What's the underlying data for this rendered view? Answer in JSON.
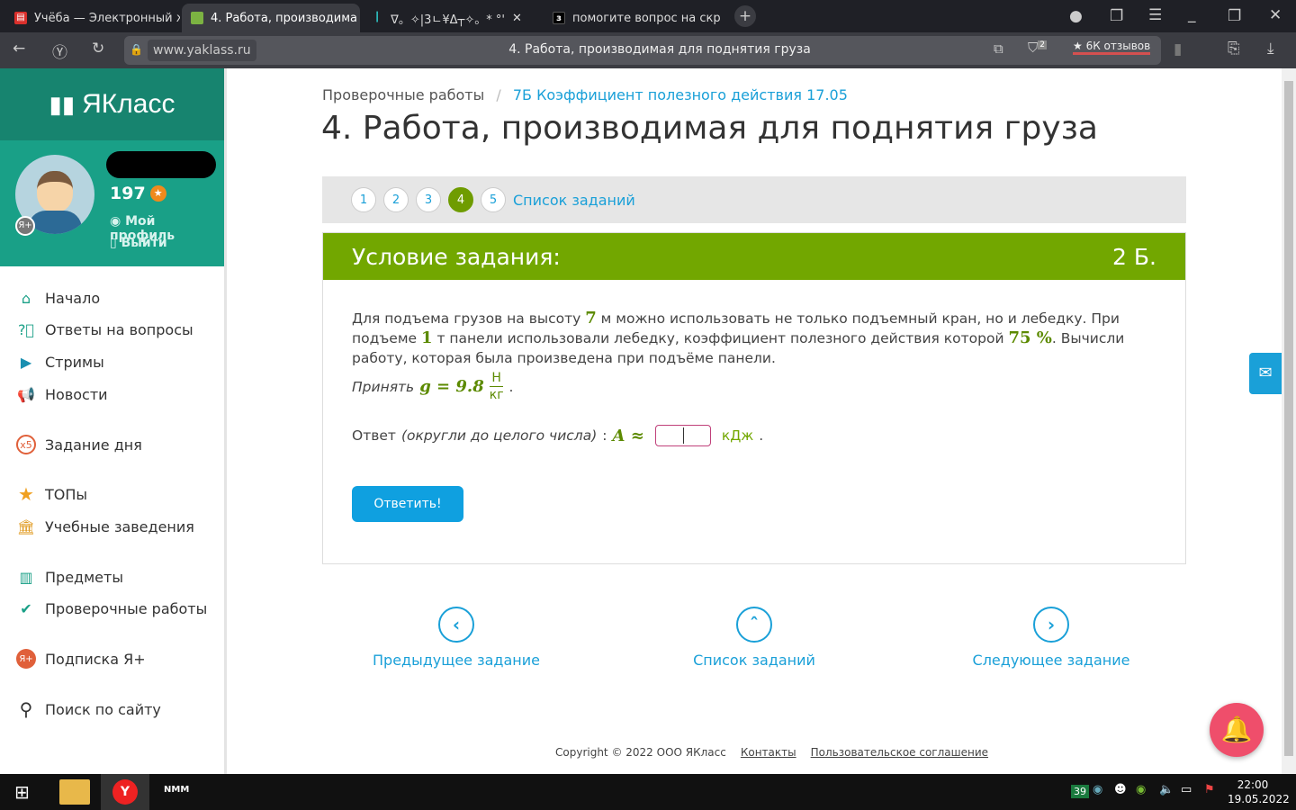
{
  "browser": {
    "tabs": [
      {
        "label": "Учёба — Электронный жу",
        "icon": "document-icon",
        "color": "#d9302c"
      },
      {
        "label": "4. Работа, производима",
        "icon": "yaklass-icon",
        "color": "#7cb342"
      },
      {
        "label": "ᐁ。✧|3ㄴ¥Δ┬✧。* °'",
        "icon": "audio-wave-icon",
        "color": "#2ec4c4"
      },
      {
        "label": "помогите вопрос на скри",
        "icon": "znanija-icon",
        "color": "#000000"
      }
    ],
    "url": "www.yaklass.ru",
    "page_title": "4. Работа, производимая для поднятия груза",
    "reviews": "★ 6К отзывов",
    "shield_badge": "2"
  },
  "sidebar": {
    "logo": "ЯКласс",
    "points": "197",
    "profile_link": "Мой профиль",
    "logout_link": "Выйти",
    "items": [
      {
        "label": "Начало",
        "icon": "home-icon"
      },
      {
        "label": "Ответы на вопросы",
        "icon": "question-icon"
      },
      {
        "label": "Стримы",
        "icon": "play-icon"
      },
      {
        "label": "Новости",
        "icon": "megaphone-icon"
      },
      {
        "label": "Задание дня",
        "icon": "x5-icon"
      },
      {
        "label": "ТОПы",
        "icon": "star-icon"
      },
      {
        "label": "Учебные заведения",
        "icon": "school-icon"
      },
      {
        "label": "Предметы",
        "icon": "books-icon"
      },
      {
        "label": "Проверочные работы",
        "icon": "check-icon"
      },
      {
        "label": "Подписка Я+",
        "icon": "ya-plus-icon"
      },
      {
        "label": "Поиск по сайту",
        "icon": "search-icon"
      }
    ]
  },
  "breadcrumb": {
    "root": "Проверочные работы",
    "sep": "/",
    "current": "7Б Коэффициент полезного действия 17.05"
  },
  "title": "4. Работа, производимая для поднятия груза",
  "task_nav": {
    "numbers": [
      "1",
      "2",
      "3",
      "4",
      "5"
    ],
    "current": "4",
    "list_link": "Список заданий"
  },
  "task": {
    "header": "Условие задания:",
    "points": "2 Б.",
    "text1": "Для подъема грузов на высоту ",
    "h": "7",
    "text2": " м можно использовать не только подъемный кран, но и лебедку. При подъеме ",
    "m": "1",
    "text3": " т панели использовали лебедку, коэффициент полезного действия которой ",
    "eff": "75 %",
    "text4": ". Вычисли работу, которая была произведена при подъёме панели.",
    "take": "Принять",
    "g_expr": "g = 9.8",
    "unit_num": "Н",
    "unit_den": "кг",
    "answer_label": "Ответ",
    "answer_hint": "(округли до целого числа)",
    "answer_var": "A ≈",
    "answer_unit": "кДж",
    "answer_value": "",
    "submit": "Ответить!"
  },
  "bottom_nav": {
    "prev": "Предыдущее задание",
    "list": "Список заданий",
    "next": "Следующее задание"
  },
  "footer": {
    "copyright": "Copyright © 2022 ООО ЯКласс",
    "contacts": "Контакты",
    "agreement": "Пользовательское соглашение"
  },
  "taskbar": {
    "badge": "39",
    "time": "22:00",
    "date": "19.05.2022"
  }
}
